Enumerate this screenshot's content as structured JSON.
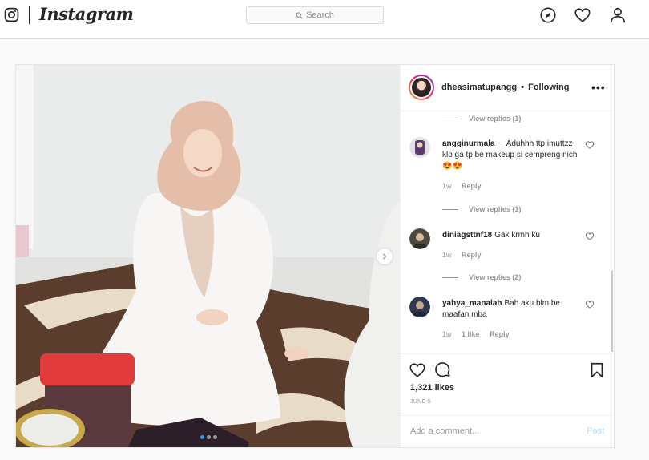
{
  "nav": {
    "logo_text": "Instagram",
    "search_placeholder": "Search",
    "icons": [
      "instagram-camera-icon",
      "compass-icon",
      "heart-icon",
      "profile-icon"
    ]
  },
  "post": {
    "username": "dheasimatupangg",
    "separator": "•",
    "follow_status": "Following",
    "more": "•••",
    "comments": [
      {
        "username": "angginurmala__",
        "text": "Aduhhh ttp imuttzz klo ga tp be makeup si cempreng nich 😍😍",
        "time": "1w",
        "reply": "Reply",
        "likes": ""
      },
      {
        "username": "diniagsttnf18",
        "text": "Gak krmh ku",
        "time": "1w",
        "reply": "Reply",
        "likes": ""
      },
      {
        "username": "yahya_manalah",
        "text": "Bah aku blm be maafan mba",
        "time": "1w",
        "reply": "Reply",
        "likes": "1 like"
      }
    ],
    "view_replies": [
      "View replies (1)",
      "View replies (1)",
      "View replies (2)"
    ],
    "likes_count": "1,321 likes",
    "date": "JUNE 5",
    "add_comment_placeholder": "Add a comment...",
    "post_button": "Post",
    "colors": {
      "accent": "#3897f0",
      "post_disabled": "#b3dbff"
    }
  }
}
